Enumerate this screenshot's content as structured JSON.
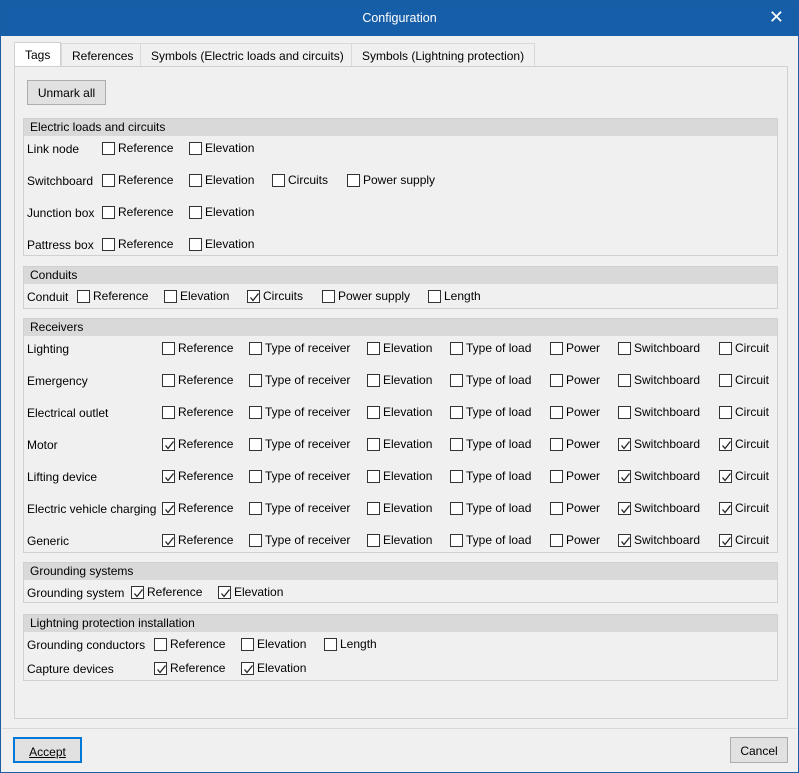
{
  "window": {
    "title": "Configuration"
  },
  "tabs": [
    {
      "label": "Tags",
      "active": true
    },
    {
      "label": "References"
    },
    {
      "label": "Symbols (Electric loads and circuits)"
    },
    {
      "label": "Symbols (Lightning protection)"
    }
  ],
  "unmark_all_label": "Unmark all",
  "sections": [
    {
      "title": "Electric loads and circuits",
      "rows": [
        {
          "label": "Link node",
          "options": [
            {
              "label": "Reference",
              "checked": false
            },
            {
              "label": "Elevation",
              "checked": false
            }
          ]
        },
        {
          "label": "Switchboard",
          "options": [
            {
              "label": "Reference",
              "checked": false
            },
            {
              "label": "Elevation",
              "checked": false
            },
            {
              "label": "Circuits",
              "checked": false
            },
            {
              "label": "Power supply",
              "checked": false
            }
          ]
        },
        {
          "label": "Junction box",
          "options": [
            {
              "label": "Reference",
              "checked": false
            },
            {
              "label": "Elevation",
              "checked": false
            }
          ]
        },
        {
          "label": "Pattress box",
          "options": [
            {
              "label": "Reference",
              "checked": false
            },
            {
              "label": "Elevation",
              "checked": false
            }
          ]
        }
      ]
    },
    {
      "title": "Conduits",
      "rows": [
        {
          "label": "Conduit",
          "options": [
            {
              "label": "Reference",
              "checked": false
            },
            {
              "label": "Elevation",
              "checked": false
            },
            {
              "label": "Circuits",
              "checked": true
            },
            {
              "label": "Power supply",
              "checked": false
            },
            {
              "label": "Length",
              "checked": false
            }
          ]
        }
      ]
    },
    {
      "title": "Receivers",
      "rows": [
        {
          "label": "Lighting",
          "options": [
            {
              "label": "Reference",
              "checked": false
            },
            {
              "label": "Type of receiver",
              "checked": false
            },
            {
              "label": "Elevation",
              "checked": false
            },
            {
              "label": "Type of load",
              "checked": false
            },
            {
              "label": "Power",
              "checked": false
            },
            {
              "label": "Switchboard",
              "checked": false
            },
            {
              "label": "Circuit",
              "checked": false
            }
          ]
        },
        {
          "label": "Emergency",
          "options": [
            {
              "label": "Reference",
              "checked": false
            },
            {
              "label": "Type of receiver",
              "checked": false
            },
            {
              "label": "Elevation",
              "checked": false
            },
            {
              "label": "Type of load",
              "checked": false
            },
            {
              "label": "Power",
              "checked": false
            },
            {
              "label": "Switchboard",
              "checked": false
            },
            {
              "label": "Circuit",
              "checked": false
            }
          ]
        },
        {
          "label": "Electrical outlet",
          "options": [
            {
              "label": "Reference",
              "checked": false
            },
            {
              "label": "Type of receiver",
              "checked": false
            },
            {
              "label": "Elevation",
              "checked": false
            },
            {
              "label": "Type of load",
              "checked": false
            },
            {
              "label": "Power",
              "checked": false
            },
            {
              "label": "Switchboard",
              "checked": false
            },
            {
              "label": "Circuit",
              "checked": false
            }
          ]
        },
        {
          "label": "Motor",
          "options": [
            {
              "label": "Reference",
              "checked": true
            },
            {
              "label": "Type of receiver",
              "checked": false
            },
            {
              "label": "Elevation",
              "checked": false
            },
            {
              "label": "Type of load",
              "checked": false
            },
            {
              "label": "Power",
              "checked": false
            },
            {
              "label": "Switchboard",
              "checked": true
            },
            {
              "label": "Circuit",
              "checked": true
            }
          ]
        },
        {
          "label": "Lifting device",
          "options": [
            {
              "label": "Reference",
              "checked": true
            },
            {
              "label": "Type of receiver",
              "checked": false
            },
            {
              "label": "Elevation",
              "checked": false
            },
            {
              "label": "Type of load",
              "checked": false
            },
            {
              "label": "Power",
              "checked": false
            },
            {
              "label": "Switchboard",
              "checked": true
            },
            {
              "label": "Circuit",
              "checked": true
            }
          ]
        },
        {
          "label": "Electric vehicle charging",
          "options": [
            {
              "label": "Reference",
              "checked": true
            },
            {
              "label": "Type of receiver",
              "checked": false
            },
            {
              "label": "Elevation",
              "checked": false
            },
            {
              "label": "Type of load",
              "checked": false
            },
            {
              "label": "Power",
              "checked": false
            },
            {
              "label": "Switchboard",
              "checked": true
            },
            {
              "label": "Circuit",
              "checked": true
            }
          ]
        },
        {
          "label": "Generic",
          "options": [
            {
              "label": "Reference",
              "checked": true
            },
            {
              "label": "Type of receiver",
              "checked": false
            },
            {
              "label": "Elevation",
              "checked": false
            },
            {
              "label": "Type of load",
              "checked": false
            },
            {
              "label": "Power",
              "checked": false
            },
            {
              "label": "Switchboard",
              "checked": true
            },
            {
              "label": "Circuit",
              "checked": true
            }
          ]
        }
      ]
    },
    {
      "title": "Grounding systems",
      "rows": [
        {
          "label": "Grounding system",
          "options": [
            {
              "label": "Reference",
              "checked": true
            },
            {
              "label": "Elevation",
              "checked": true
            }
          ]
        }
      ]
    },
    {
      "title": "Lightning protection installation",
      "rows": [
        {
          "label": "Grounding conductors",
          "options": [
            {
              "label": "Reference",
              "checked": false
            },
            {
              "label": "Elevation",
              "checked": false
            },
            {
              "label": "Length",
              "checked": false
            }
          ]
        },
        {
          "label": "Capture devices",
          "options": [
            {
              "label": "Reference",
              "checked": true
            },
            {
              "label": "Elevation",
              "checked": true
            }
          ]
        }
      ]
    }
  ],
  "buttons": {
    "accept": "Accept",
    "cancel": "Cancel"
  }
}
